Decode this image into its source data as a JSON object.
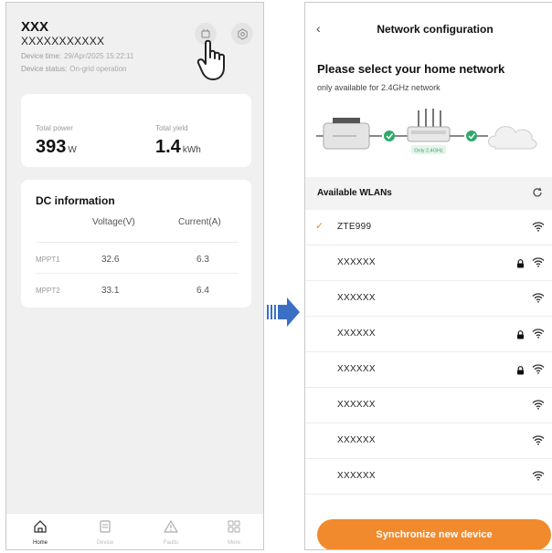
{
  "home": {
    "device_name": "XXX",
    "serial_number": "XXXXXXXXXXX",
    "device_time_label": "Device time:",
    "device_time_value": "29/Apr/2025 15:22:11",
    "device_status_label": "Device status:",
    "device_status_value": "On-grid operation",
    "total_power_label": "Total power",
    "total_power_value": "393",
    "total_power_unit": "W",
    "total_yield_label": "Total yield",
    "total_yield_value": "1.4",
    "total_yield_unit": "kWh",
    "dc_title": "DC information",
    "dc_columns": [
      "Voltage(V)",
      "Current(A)"
    ],
    "dc_rows": [
      {
        "label": "MPPT1",
        "voltage": "32.6",
        "current": "6.3"
      },
      {
        "label": "MPPT2",
        "voltage": "33.1",
        "current": "6.4"
      }
    ],
    "tabs": [
      {
        "label": "Home",
        "icon": "home-icon"
      },
      {
        "label": "Device",
        "icon": "device-icon"
      },
      {
        "label": "Faults",
        "icon": "warning-icon"
      },
      {
        "label": "More",
        "icon": "grid-icon"
      }
    ]
  },
  "network": {
    "title": "Network configuration",
    "heading": "Please select your home network",
    "subheading": "only available for 2.4GHz network",
    "router_badge": "Only 2.4GHz",
    "wlan_section_title": "Available WLANs",
    "wlans": [
      {
        "name": "ZTE999",
        "selected": true,
        "locked": false
      },
      {
        "name": "XXXXXX",
        "selected": false,
        "locked": true
      },
      {
        "name": "XXXXXX",
        "selected": false,
        "locked": false
      },
      {
        "name": "XXXXXX",
        "selected": false,
        "locked": true
      },
      {
        "name": "XXXXXX",
        "selected": false,
        "locked": true
      },
      {
        "name": "XXXXXX",
        "selected": false,
        "locked": false
      },
      {
        "name": "XXXXXX",
        "selected": false,
        "locked": false
      },
      {
        "name": "XXXXXX",
        "selected": false,
        "locked": false
      }
    ],
    "sync_button_label": "Synchronize new device"
  },
  "colors": {
    "accent": "#f08a2c",
    "check_green": "#2ea86b",
    "arrow_blue": "#3b6fc4"
  }
}
